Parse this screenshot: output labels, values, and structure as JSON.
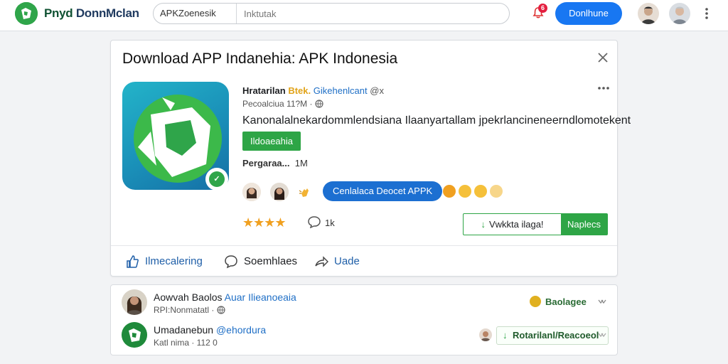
{
  "topbar": {
    "logo_icon": "download-logo-icon",
    "brand_a": "Pnyd",
    "brand_b": "DonnMclan",
    "search_scope": "APKZoenesik",
    "search_placeholder": "Inktutak",
    "notification_count": "6",
    "action_button": "Donlhune",
    "more_icon": "kebab-vertical-icon"
  },
  "card": {
    "title": "Download APP Indanehia: APK Indonesia",
    "close_icon": "close-icon",
    "app_icon": "app-download-icon",
    "verified_icon": "verified-check-icon",
    "author_name": "Hratarilan",
    "author_highlight": "Btek.",
    "author_handle": "Gikehenlcant",
    "author_at": "@x",
    "meta_time": "Pecoalciua 11?M",
    "meta_sep": "·",
    "description": "Kanonalalnekardommlendsiana Ilaanyartallam jpekrlancineneerndlomotekent",
    "tag_label": "Ildoaeahia",
    "stats_label": "Pergaraa...",
    "stats_value": "1M",
    "download_pill": "Cenlalaca Deocet APPK",
    "rating_stars": "★★★★",
    "rating_value": 4,
    "comment_count": "1k",
    "split_left": "Vwkkta ilaga!",
    "split_right": "Naplecs",
    "actions": [
      {
        "icon": "thumbs-up-icon",
        "label": "Ilmecalering"
      },
      {
        "icon": "comment-icon",
        "label": "Soemhlaes"
      },
      {
        "icon": "share-arrow-icon",
        "label": "Uade"
      }
    ]
  },
  "comments": [
    {
      "name": "Aowvah Baolos",
      "group": "Auar Ilieanoeaia",
      "meta": "RPI:Nonmatatl ·",
      "badge": "Baolagee",
      "chevron": "chevron-down-icon"
    },
    {
      "name": "Umadanebun",
      "group": "@ehordura",
      "meta": "Katl nima · 112 0",
      "reply_label": "Rotarilanl/Reacoeol",
      "chevron": "chevron-down-icon"
    }
  ],
  "colors": {
    "primary_blue": "#1877f2",
    "accent_green": "#2ea546",
    "star": "#f0a020"
  }
}
